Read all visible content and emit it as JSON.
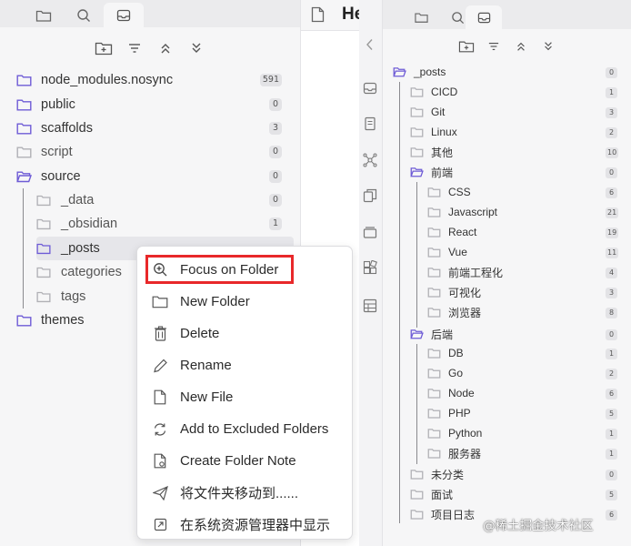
{
  "colors": {
    "folder_icon": "#6e5bd6",
    "highlight_border": "#e8282a",
    "sidebar_bg": "#f6f6f7"
  },
  "left": {
    "tabs": [
      {
        "icon": "folder-icon"
      },
      {
        "icon": "search-icon"
      },
      {
        "icon": "inbox-icon"
      }
    ],
    "editor_title": "He",
    "tree": [
      {
        "label": "node_modules.nosync",
        "count": "591",
        "open": false
      },
      {
        "label": "public",
        "count": "0",
        "open": false
      },
      {
        "label": "scaffolds",
        "count": "3",
        "open": false
      },
      {
        "label": "script",
        "count": "0",
        "open": false
      },
      {
        "label": "source",
        "count": "0",
        "open": true
      },
      {
        "label": "_data",
        "count": "0",
        "open": false
      },
      {
        "label": "_obsidian",
        "count": "1",
        "open": false
      },
      {
        "label": "_posts",
        "open": false
      },
      {
        "label": "categories",
        "open": false
      },
      {
        "label": "tags",
        "open": false
      },
      {
        "label": "themes",
        "open": false
      }
    ],
    "context_menu": [
      {
        "label": "Focus on Folder",
        "icon": "zoom-in-icon"
      },
      {
        "label": "New Folder",
        "icon": "folder-icon"
      },
      {
        "label": "Delete",
        "icon": "trash-icon"
      },
      {
        "label": "Rename",
        "icon": "pencil-icon"
      },
      {
        "label": "New File",
        "icon": "file-icon"
      },
      {
        "label": "Add to Excluded Folders",
        "icon": "refresh-icon"
      },
      {
        "label": "Create Folder Note",
        "icon": "file-gear-icon"
      },
      {
        "label": "将文件夹移动到......",
        "icon": "send-icon"
      },
      {
        "label": "在系统资源管理器中显示",
        "icon": "external-link-icon"
      }
    ]
  },
  "right": {
    "tree": [
      {
        "label": "_posts",
        "count": "0",
        "open": true
      },
      {
        "label": "CICD",
        "count": "1"
      },
      {
        "label": "Git",
        "count": "3"
      },
      {
        "label": "Linux",
        "count": "2"
      },
      {
        "label": "其他",
        "count": "10"
      },
      {
        "label": "前端",
        "count": "0",
        "open": true
      },
      {
        "label": "CSS",
        "count": "6"
      },
      {
        "label": "Javascript",
        "count": "21"
      },
      {
        "label": "React",
        "count": "19"
      },
      {
        "label": "Vue",
        "count": "11"
      },
      {
        "label": "前端工程化",
        "count": "4"
      },
      {
        "label": "可视化",
        "count": "3"
      },
      {
        "label": "浏览器",
        "count": "8"
      },
      {
        "label": "后端",
        "count": "0",
        "open": true
      },
      {
        "label": "DB",
        "count": "1"
      },
      {
        "label": "Go",
        "count": "2"
      },
      {
        "label": "Node",
        "count": "6"
      },
      {
        "label": "PHP",
        "count": "5"
      },
      {
        "label": "Python",
        "count": "1"
      },
      {
        "label": "服务器",
        "count": "1"
      },
      {
        "label": "未分类",
        "count": "0"
      },
      {
        "label": "面试",
        "count": "5"
      },
      {
        "label": "项目日志",
        "count": "6"
      }
    ]
  },
  "watermark": "@稀土掘金技术社区"
}
